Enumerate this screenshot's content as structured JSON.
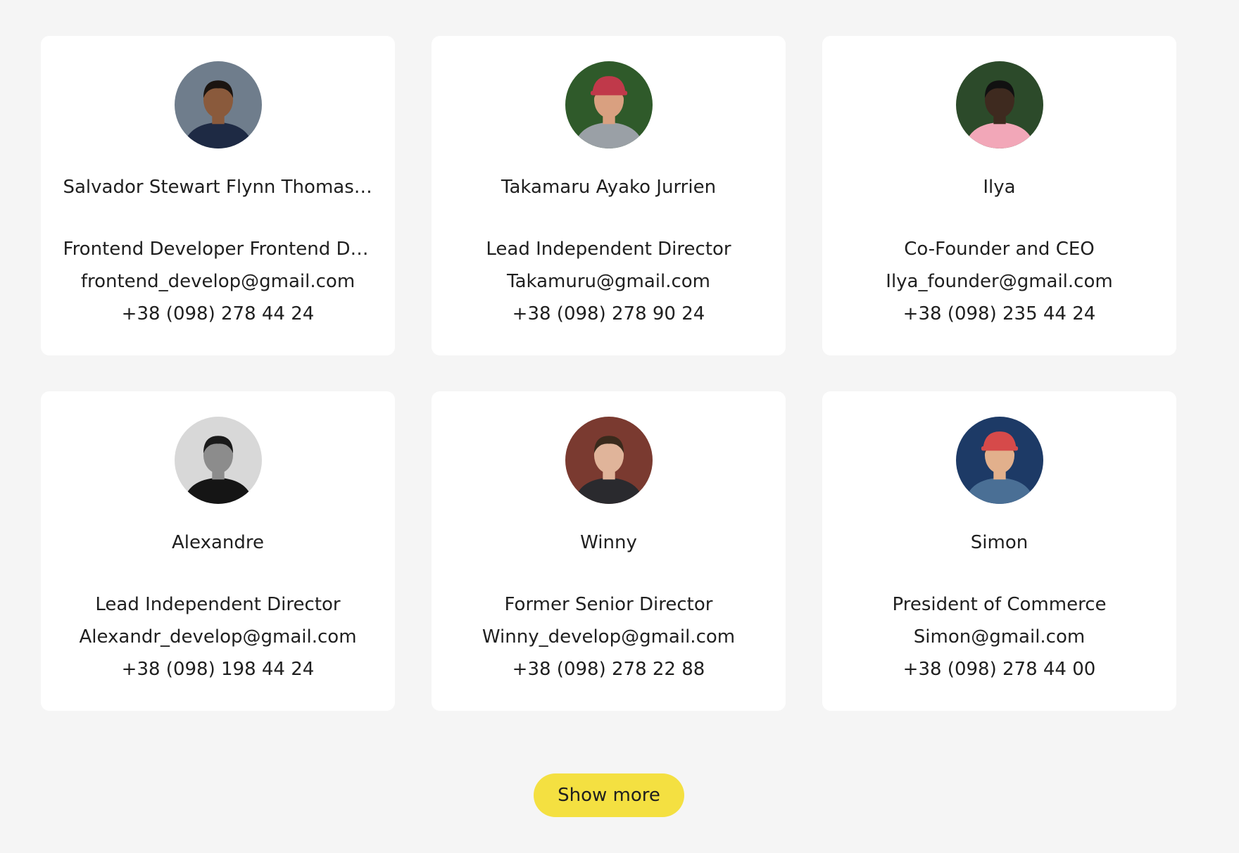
{
  "users": [
    {
      "name": "Salvador Stewart Flynn Thomas Salvador Stewart Flynn Thomas",
      "position": "Frontend Developer Frontend Developer",
      "email": "frontend_develop@gmail.com",
      "phone": "+38 (098) 278 44 24",
      "avatar": {
        "bg": "#6f7d8c",
        "skin": "#8a5a3c",
        "hair": "#1b1410",
        "shirt": "#1e2a44",
        "cap": ""
      }
    },
    {
      "name": "Takamaru Ayako Jurrien",
      "position": "Lead Independent Director",
      "email": "Takamuru@gmail.com",
      "phone": "+38 (098) 278 90 24",
      "avatar": {
        "bg": "#2f5a2a",
        "skin": "#d9a080",
        "hair": "#5a3a22",
        "shirt": "#9aa0a6",
        "cap": "#c0394a"
      }
    },
    {
      "name": "Ilya",
      "position": "Co-Founder and CEO",
      "email": "Ilya_founder@gmail.com",
      "phone": "+38 (098) 235 44 24",
      "avatar": {
        "bg": "#2c4a2a",
        "skin": "#3e2a1f",
        "hair": "#111111",
        "shirt": "#f2a7b8",
        "cap": ""
      }
    },
    {
      "name": "Alexandre",
      "position": "Lead Independent Director",
      "email": "Alexandr_develop@gmail.com",
      "phone": "+38 (098) 198 44 24",
      "avatar": {
        "bg": "#d8d8d8",
        "skin": "#8c8c8c",
        "hair": "#1a1a1a",
        "shirt": "#151515",
        "cap": ""
      }
    },
    {
      "name": "Winny",
      "position": "Former Senior Director",
      "email": "Winny_develop@gmail.com",
      "phone": "+38 (098) 278 22 88",
      "avatar": {
        "bg": "#7a3a30",
        "skin": "#e0b49a",
        "hair": "#3a2a1c",
        "shirt": "#2a2a2e",
        "cap": ""
      }
    },
    {
      "name": "Simon",
      "position": "President of Commerce",
      "email": "Simon@gmail.com",
      "phone": "+38 (098) 278 44 00",
      "avatar": {
        "bg": "#1d3a66",
        "skin": "#e2b08c",
        "hair": "#4a2e1c",
        "shirt": "#4a6f95",
        "cap": "#d64a4a"
      }
    }
  ],
  "show_more_label": "Show more",
  "colors": {
    "page_bg": "#f5f5f5",
    "card_bg": "#ffffff",
    "button_bg": "#f4e041",
    "text": "#1f1f1f"
  }
}
